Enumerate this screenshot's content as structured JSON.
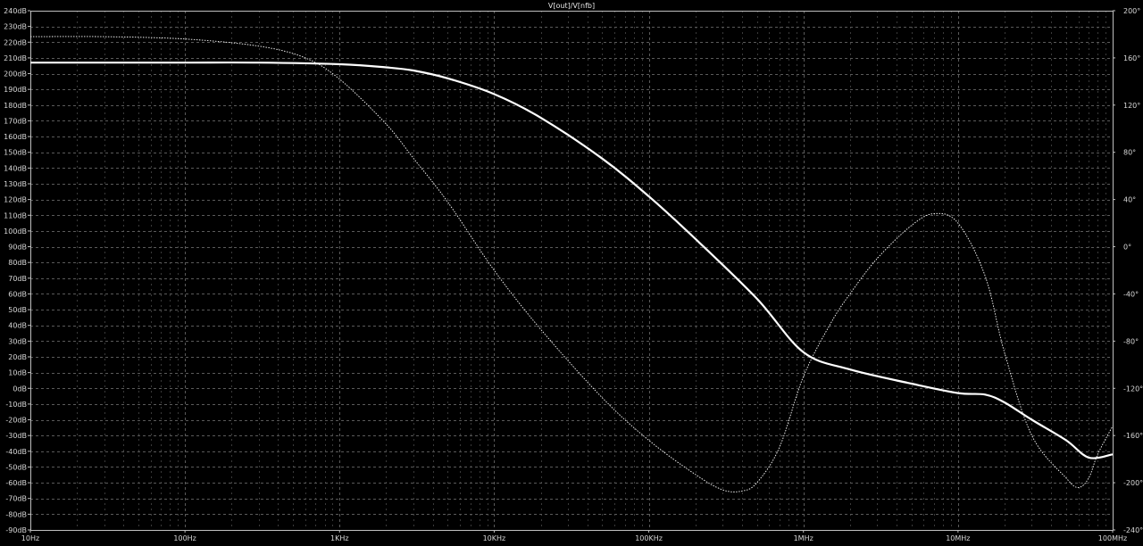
{
  "chart_data": {
    "type": "line",
    "title": "V[out]/V[nfb]",
    "x_scale": "log",
    "xlim": [
      10,
      100000000
    ],
    "x_ticks": [
      {
        "value": 10,
        "label": "10Hz"
      },
      {
        "value": 100,
        "label": "100Hz"
      },
      {
        "value": 1000,
        "label": "1KHz"
      },
      {
        "value": 10000,
        "label": "10KHz"
      },
      {
        "value": 100000,
        "label": "100KHz"
      },
      {
        "value": 1000000,
        "label": "1MHz"
      },
      {
        "value": 10000000,
        "label": "10MHz"
      },
      {
        "value": 100000000,
        "label": "100MHz"
      }
    ],
    "y_left": {
      "unit": "dB",
      "lim": [
        -90,
        240
      ],
      "step": 10,
      "tick_labels": [
        "240dB",
        "230dB",
        "220dB",
        "210dB",
        "200dB",
        "190dB",
        "180dB",
        "170dB",
        "160dB",
        "150dB",
        "140dB",
        "130dB",
        "120dB",
        "110dB",
        "100dB",
        "90dB",
        "80dB",
        "70dB",
        "60dB",
        "50dB",
        "40dB",
        "30dB",
        "20dB",
        "10dB",
        "0dB",
        "-10dB",
        "-20dB",
        "-30dB",
        "-40dB",
        "-50dB",
        "-60dB",
        "-70dB",
        "-80dB",
        "-90dB"
      ]
    },
    "y_right": {
      "unit": "°",
      "lim": [
        -240,
        200
      ],
      "step": 40,
      "tick_labels": [
        "200°",
        "160°",
        "120°",
        "80°",
        "40°",
        "0°",
        "-40°",
        "-80°",
        "-120°",
        "-160°",
        "-200°",
        "-240°"
      ]
    },
    "grid": true,
    "series": [
      {
        "style": "solid",
        "axis": "left",
        "x": [
          10,
          30,
          100,
          300,
          1000,
          2000,
          3000,
          5000,
          10000,
          20000,
          50000,
          100000,
          200000,
          500000,
          1000000,
          2000000,
          5000000,
          10000000,
          15000000,
          20000000,
          30000000,
          50000000,
          70000000,
          100000000
        ],
        "values": [
          207,
          207,
          207,
          207,
          206,
          204,
          202,
          197,
          187,
          172,
          146,
          122,
          95,
          57,
          23,
          12,
          3,
          -3,
          -4,
          -9,
          -20,
          -33,
          -44,
          -42
        ]
      },
      {
        "style": "dotted",
        "axis": "right",
        "x": [
          10,
          30,
          100,
          300,
          600,
          1000,
          2000,
          3000,
          5000,
          10000,
          20000,
          50000,
          100000,
          200000,
          300000,
          400000,
          500000,
          700000,
          1000000,
          1500000,
          2000000,
          3000000,
          5000000,
          7000000,
          10000000,
          15000000,
          20000000,
          30000000,
          50000000,
          60000000,
          70000000,
          80000000,
          100000000
        ],
        "values": [
          178,
          178,
          176,
          170,
          160,
          142,
          104,
          75,
          38,
          -20,
          -70,
          -128,
          -164,
          -193,
          -206,
          -207,
          -200,
          -170,
          -110,
          -65,
          -40,
          -10,
          18,
          28,
          20,
          -25,
          -90,
          -160,
          -196,
          -204,
          -196,
          -176,
          -152
        ]
      }
    ]
  }
}
